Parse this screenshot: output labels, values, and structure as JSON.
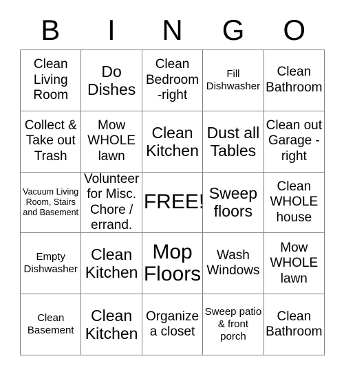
{
  "header": {
    "letters": [
      "B",
      "I",
      "N",
      "G",
      "O"
    ]
  },
  "grid": {
    "columns": 5,
    "rows": 5,
    "cells": [
      [
        {
          "text": "Clean Living Room",
          "size": "md"
        },
        {
          "text": "Do Dishes",
          "size": "lg"
        },
        {
          "text": "Clean Bedroom -right",
          "size": "md"
        },
        {
          "text": "Fill Dishwasher",
          "size": "sm"
        },
        {
          "text": "Clean Bathroom",
          "size": "md"
        }
      ],
      [
        {
          "text": "Collect & Take out Trash",
          "size": "md"
        },
        {
          "text": "Mow WHOLE lawn",
          "size": "md"
        },
        {
          "text": "Clean Kitchen",
          "size": "lg"
        },
        {
          "text": "Dust all Tables",
          "size": "lg"
        },
        {
          "text": "Clean out Garage - right",
          "size": "md"
        }
      ],
      [
        {
          "text": "Vacuum Living Room, Stairs and Basement",
          "size": "xs"
        },
        {
          "text": "Volunteer for Misc. Chore / errand.",
          "size": "md"
        },
        {
          "text": "FREE!",
          "size": "xl"
        },
        {
          "text": "Sweep floors",
          "size": "lg"
        },
        {
          "text": "Clean WHOLE house",
          "size": "md"
        }
      ],
      [
        {
          "text": "Empty Dishwasher",
          "size": "sm"
        },
        {
          "text": "Clean Kitchen",
          "size": "lg"
        },
        {
          "text": "Mop Floors",
          "size": "xl"
        },
        {
          "text": "Wash Windows",
          "size": "md"
        },
        {
          "text": "Mow WHOLE lawn",
          "size": "md"
        }
      ],
      [
        {
          "text": "Clean Basement",
          "size": "sm"
        },
        {
          "text": "Clean Kitchen",
          "size": "lg"
        },
        {
          "text": "Organize a closet",
          "size": "md"
        },
        {
          "text": "Sweep patio & front porch",
          "size": "sm"
        },
        {
          "text": "Clean Bathroom",
          "size": "md"
        }
      ]
    ]
  },
  "colors": {
    "background": "#ffffff",
    "text": "#000000",
    "border": "#808080"
  }
}
